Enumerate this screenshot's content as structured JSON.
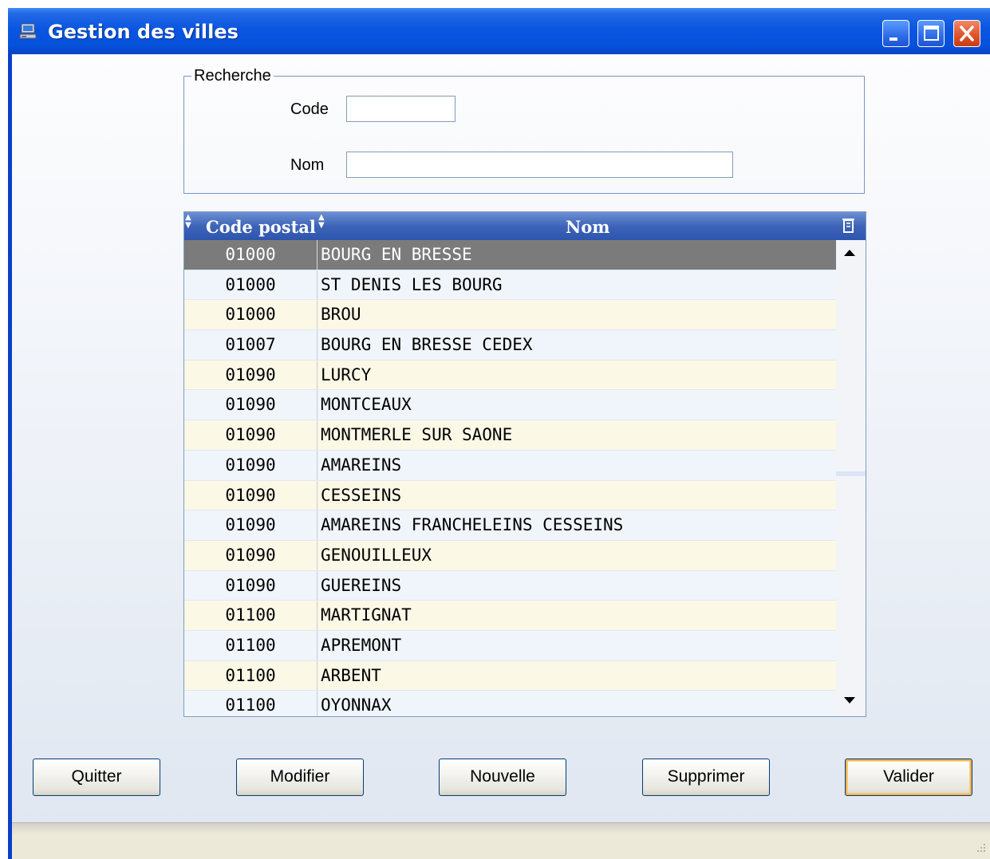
{
  "window": {
    "title": "Gestion des villes",
    "colors": {
      "titlebar": "#0652dc",
      "selection": "#7b7b7b",
      "row_odd": "#fbf8e6",
      "row_even": "#f0f5fc"
    }
  },
  "search": {
    "group_label": "Recherche",
    "code_label": "Code",
    "code_value": "",
    "nom_label": "Nom",
    "nom_value": ""
  },
  "table": {
    "headers": {
      "code": "Code postal",
      "nom": "Nom"
    },
    "rows": [
      {
        "code": "01000",
        "nom": "BOURG EN BRESSE",
        "selected": true
      },
      {
        "code": "01000",
        "nom": "ST DENIS LES BOURG"
      },
      {
        "code": "01000",
        "nom": "BROU"
      },
      {
        "code": "01007",
        "nom": "BOURG EN BRESSE CEDEX"
      },
      {
        "code": "01090",
        "nom": "LURCY"
      },
      {
        "code": "01090",
        "nom": "MONTCEAUX"
      },
      {
        "code": "01090",
        "nom": "MONTMERLE SUR SAONE"
      },
      {
        "code": "01090",
        "nom": "AMAREINS"
      },
      {
        "code": "01090",
        "nom": "CESSEINS"
      },
      {
        "code": "01090",
        "nom": "AMAREINS FRANCHELEINS CESSEINS"
      },
      {
        "code": "01090",
        "nom": "GENOUILLEUX"
      },
      {
        "code": "01090",
        "nom": "GUEREINS"
      },
      {
        "code": "01100",
        "nom": "MARTIGNAT"
      },
      {
        "code": "01100",
        "nom": "APREMONT"
      },
      {
        "code": "01100",
        "nom": "ARBENT"
      },
      {
        "code": "01100",
        "nom": "OYONNAX"
      }
    ]
  },
  "buttons": {
    "quitter": "Quitter",
    "modifier": "Modifier",
    "nouvelle": "Nouvelle",
    "supprimer": "Supprimer",
    "valider": "Valider"
  },
  "icons": {
    "app": "computer-icon",
    "sort": "sort-arrows-icon",
    "columns": "column-chooser-icon",
    "scroll_up": "arrow-up-icon",
    "scroll_down": "arrow-down-icon"
  }
}
